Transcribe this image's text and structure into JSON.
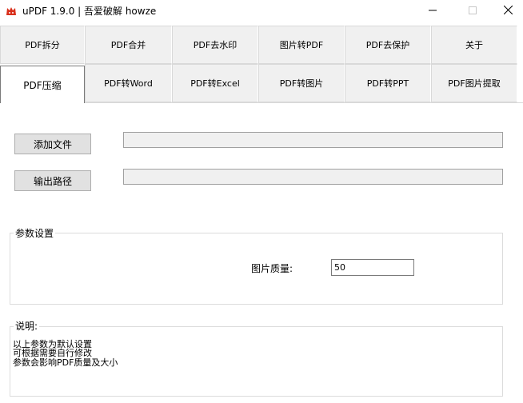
{
  "window": {
    "title": "uPDF 1.9.0 | 吾爱破解 howze",
    "icons": {
      "app": "fox-logo-icon",
      "minimize": "minimize-icon",
      "maximize": "maximize-icon",
      "close": "close-icon"
    }
  },
  "tabs_row1": [
    {
      "label": "PDF拆分"
    },
    {
      "label": "PDF合并"
    },
    {
      "label": "PDF去水印"
    },
    {
      "label": "图片转PDF"
    },
    {
      "label": "PDF去保护"
    },
    {
      "label": "关于"
    }
  ],
  "tabs_row2": [
    {
      "label": "PDF压缩",
      "active": true
    },
    {
      "label": "PDF转Word"
    },
    {
      "label": "PDF转Excel"
    },
    {
      "label": "PDF转图片"
    },
    {
      "label": "PDF转PPT"
    },
    {
      "label": "PDF图片提取"
    }
  ],
  "actions": {
    "add_file_label": "添加文件",
    "output_path_label": "输出路径",
    "add_file_value": "",
    "output_path_value": ""
  },
  "params": {
    "group_title": "参数设置",
    "quality_label": "图片质量:",
    "quality_value": "50"
  },
  "description": {
    "group_title": "说明:",
    "lines": [
      "以上参数为默认设置",
      "可根据需要自行修改",
      "参数会影响PDF质量及大小"
    ]
  },
  "colors": {
    "tab_bg": "#f0f0f0",
    "button_bg": "#e1e1e1",
    "field_bg": "#f0f0f0",
    "app_icon_red": "#d9301c"
  }
}
